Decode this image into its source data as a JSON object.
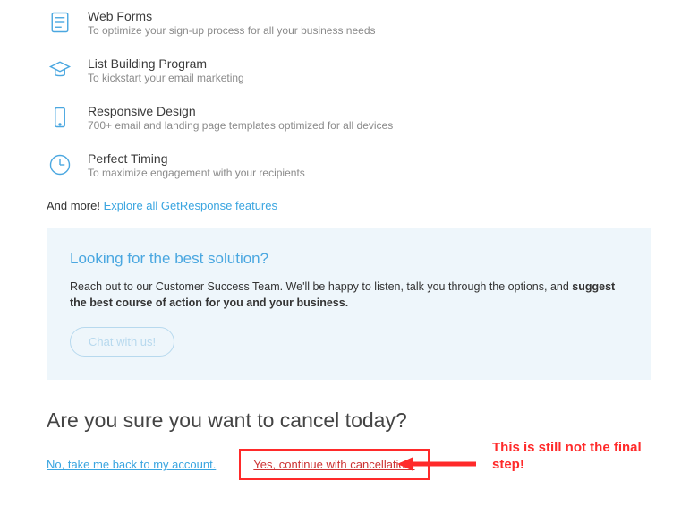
{
  "features": [
    {
      "title": "Web Forms",
      "desc": "To optimize your sign-up process for all your business needs"
    },
    {
      "title": "List Building Program",
      "desc": "To kickstart your email marketing"
    },
    {
      "title": "Responsive Design",
      "desc": "700+ email and landing page templates optimized for all devices"
    },
    {
      "title": "Perfect Timing",
      "desc": "To maximize engagement with your recipients"
    }
  ],
  "and_more_prefix": "And more! ",
  "and_more_link": "Explore all GetResponse features",
  "panel": {
    "title": "Looking for the best solution?",
    "body_prefix": "Reach out to our Customer Success Team. We'll be happy to listen, talk you through the options, and ",
    "body_bold": "suggest the best course of action for you and your business.",
    "chat_button": "Chat with us!"
  },
  "cancel_heading": "Are you sure you want to cancel today?",
  "actions": {
    "back": "No, take me back to my account.",
    "continue": "Yes, continue with cancellation."
  },
  "annotation": "This is still not the final step!"
}
